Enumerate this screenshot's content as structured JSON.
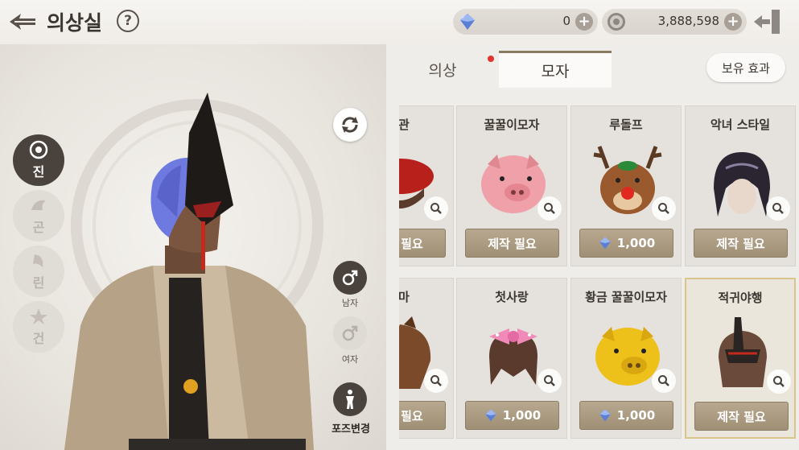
{
  "header": {
    "title": "의상실",
    "help_icon": "question-circle-icon",
    "gems": {
      "icon": "blue-gem-icon",
      "value": "0"
    },
    "coins": {
      "icon": "silver-coin-icon",
      "value": "3,888,598"
    },
    "exit_icon": "exit-door-icon"
  },
  "stage": {
    "races": [
      {
        "label": "진",
        "icon": "jin-emblem-icon",
        "active": true
      },
      {
        "label": "곤",
        "icon": "gon-emblem-icon",
        "active": false
      },
      {
        "label": "린",
        "icon": "lyn-emblem-icon",
        "active": false
      },
      {
        "label": "건",
        "icon": "gun-emblem-icon",
        "active": false
      }
    ],
    "gender_male_label": "남자",
    "gender_female_label": "여자",
    "pose_label": "포즈변경"
  },
  "tabs": [
    {
      "label": "의상",
      "active": false,
      "has_notification": true
    },
    {
      "label": "모자",
      "active": true,
      "has_notification": false
    }
  ],
  "effect_button": "보유 효과",
  "items": [
    {
      "name": "봉관",
      "art": "red-beret-icon",
      "price_type": "craft",
      "action": "제작 필요",
      "selected": false
    },
    {
      "name": "꿀꿀이모자",
      "art": "pink-pig-hat-icon",
      "price_type": "craft",
      "action": "제작 필요",
      "selected": false
    },
    {
      "name": "루돌프",
      "art": "reindeer-hat-icon",
      "price_type": "gem",
      "action": "1,000",
      "selected": false
    },
    {
      "name": "악녀 스타일",
      "art": "dark-hair-icon",
      "price_type": "craft",
      "action": "제작 필요",
      "selected": false
    },
    {
      "name": "수마",
      "art": "horse-mask-icon",
      "price_type": "craft",
      "action": "제작 필요",
      "selected": false
    },
    {
      "name": "첫사랑",
      "art": "pink-bow-hair-icon",
      "price_type": "gem",
      "action": "1,000",
      "selected": false
    },
    {
      "name": "황금 꿀꿀이모자",
      "art": "gold-pig-hat-icon",
      "price_type": "gem",
      "action": "1,000",
      "selected": false
    },
    {
      "name": "적귀야행",
      "art": "red-oni-helm-icon",
      "price_type": "craft",
      "action": "제작 필요",
      "selected": true
    }
  ],
  "colors": {
    "accent_dark": "#4a423c",
    "button_gold": "#a89880",
    "notification_red": "#e0352e",
    "selected_border": "#d9c489"
  }
}
